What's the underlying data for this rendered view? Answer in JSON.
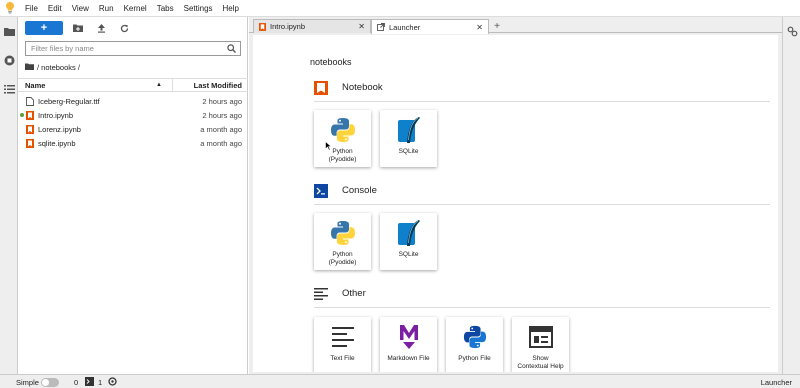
{
  "menubar": {
    "logo": "jupyter-lite-icon",
    "items": [
      "File",
      "Edit",
      "View",
      "Run",
      "Kernel",
      "Tabs",
      "Settings",
      "Help"
    ]
  },
  "filebrowser": {
    "new_label": "+",
    "search_placeholder": "Filter files by name",
    "breadcrumb": "/ notebooks /",
    "header_name": "Name",
    "header_modified": "Last Modified",
    "files": [
      {
        "name": "Iceberg-Regular.ttf",
        "modified": "2 hours ago",
        "icon": "file-icon",
        "running": false
      },
      {
        "name": "Intro.ipynb",
        "modified": "2 hours ago",
        "icon": "notebook-icon",
        "running": true
      },
      {
        "name": "Lorenz.ipynb",
        "modified": "a month ago",
        "icon": "notebook-icon",
        "running": false
      },
      {
        "name": "sqlite.ipynb",
        "modified": "a month ago",
        "icon": "notebook-icon",
        "running": false
      }
    ]
  },
  "tabs": [
    {
      "label": "Intro.ipynb",
      "icon": "notebook-icon",
      "active": false
    },
    {
      "label": "Launcher",
      "icon": "launcher-icon",
      "active": true
    }
  ],
  "launcher": {
    "cwd": "notebooks",
    "sections": {
      "notebook": {
        "title": "Notebook",
        "cards": [
          {
            "label": "Python\n(Pyodide)",
            "icon": "python-icon"
          },
          {
            "label": "SQLite",
            "icon": "sqlite-icon"
          }
        ]
      },
      "console": {
        "title": "Console",
        "cards": [
          {
            "label": "Python\n(Pyodide)",
            "icon": "python-icon"
          },
          {
            "label": "SQLite",
            "icon": "sqlite-icon"
          }
        ]
      },
      "other": {
        "title": "Other",
        "cards": [
          {
            "label": "Text File",
            "icon": "text-file-icon"
          },
          {
            "label": "Markdown File",
            "icon": "markdown-icon"
          },
          {
            "label": "Python File",
            "icon": "python-icon"
          },
          {
            "label": "Show\nContextual Help",
            "icon": "contextual-help-icon"
          }
        ]
      }
    }
  },
  "statusbar": {
    "mode_label": "Simple",
    "terminals": "0",
    "kernels": "1",
    "right_label": "Launcher"
  },
  "colors": {
    "accent": "#1976d2",
    "notebook_orange": "#e65100",
    "console_blue": "#0d47a1",
    "markdown_purple": "#7b1fa2",
    "running_green": "#5a9e3d"
  }
}
